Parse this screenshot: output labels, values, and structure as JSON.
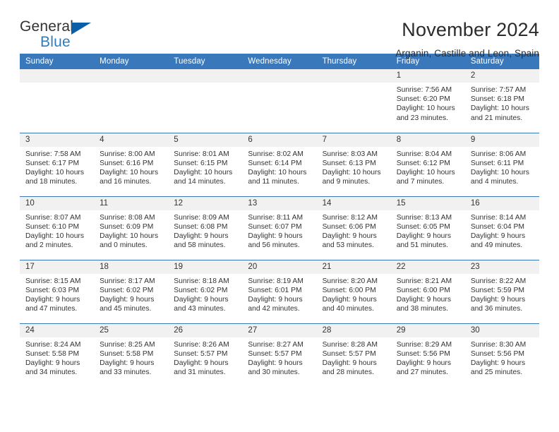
{
  "logo": {
    "word1": "General",
    "word2": "Blue",
    "triangle_color": "#0a5fa8",
    "blue_color": "#2e7bbf"
  },
  "header": {
    "title": "November 2024",
    "subtitle": "Arganin, Castille and Leon, Spain"
  },
  "theme": {
    "header_blue": "#3a78bc",
    "daynum_gray": "#f1f1f1",
    "text": "#333333"
  },
  "calendar": {
    "weekdays": [
      "Sunday",
      "Monday",
      "Tuesday",
      "Wednesday",
      "Thursday",
      "Friday",
      "Saturday"
    ],
    "weeks": [
      [
        {
          "day": "",
          "sunrise": "",
          "sunset": "",
          "daylight": "",
          "empty": true
        },
        {
          "day": "",
          "sunrise": "",
          "sunset": "",
          "daylight": "",
          "empty": true
        },
        {
          "day": "",
          "sunrise": "",
          "sunset": "",
          "daylight": "",
          "empty": true
        },
        {
          "day": "",
          "sunrise": "",
          "sunset": "",
          "daylight": "",
          "empty": true
        },
        {
          "day": "",
          "sunrise": "",
          "sunset": "",
          "daylight": "",
          "empty": true
        },
        {
          "day": "1",
          "sunrise": "Sunrise: 7:56 AM",
          "sunset": "Sunset: 6:20 PM",
          "daylight": "Daylight: 10 hours and 23 minutes."
        },
        {
          "day": "2",
          "sunrise": "Sunrise: 7:57 AM",
          "sunset": "Sunset: 6:18 PM",
          "daylight": "Daylight: 10 hours and 21 minutes."
        }
      ],
      [
        {
          "day": "3",
          "sunrise": "Sunrise: 7:58 AM",
          "sunset": "Sunset: 6:17 PM",
          "daylight": "Daylight: 10 hours and 18 minutes."
        },
        {
          "day": "4",
          "sunrise": "Sunrise: 8:00 AM",
          "sunset": "Sunset: 6:16 PM",
          "daylight": "Daylight: 10 hours and 16 minutes."
        },
        {
          "day": "5",
          "sunrise": "Sunrise: 8:01 AM",
          "sunset": "Sunset: 6:15 PM",
          "daylight": "Daylight: 10 hours and 14 minutes."
        },
        {
          "day": "6",
          "sunrise": "Sunrise: 8:02 AM",
          "sunset": "Sunset: 6:14 PM",
          "daylight": "Daylight: 10 hours and 11 minutes."
        },
        {
          "day": "7",
          "sunrise": "Sunrise: 8:03 AM",
          "sunset": "Sunset: 6:13 PM",
          "daylight": "Daylight: 10 hours and 9 minutes."
        },
        {
          "day": "8",
          "sunrise": "Sunrise: 8:04 AM",
          "sunset": "Sunset: 6:12 PM",
          "daylight": "Daylight: 10 hours and 7 minutes."
        },
        {
          "day": "9",
          "sunrise": "Sunrise: 8:06 AM",
          "sunset": "Sunset: 6:11 PM",
          "daylight": "Daylight: 10 hours and 4 minutes."
        }
      ],
      [
        {
          "day": "10",
          "sunrise": "Sunrise: 8:07 AM",
          "sunset": "Sunset: 6:10 PM",
          "daylight": "Daylight: 10 hours and 2 minutes."
        },
        {
          "day": "11",
          "sunrise": "Sunrise: 8:08 AM",
          "sunset": "Sunset: 6:09 PM",
          "daylight": "Daylight: 10 hours and 0 minutes."
        },
        {
          "day": "12",
          "sunrise": "Sunrise: 8:09 AM",
          "sunset": "Sunset: 6:08 PM",
          "daylight": "Daylight: 9 hours and 58 minutes."
        },
        {
          "day": "13",
          "sunrise": "Sunrise: 8:11 AM",
          "sunset": "Sunset: 6:07 PM",
          "daylight": "Daylight: 9 hours and 56 minutes."
        },
        {
          "day": "14",
          "sunrise": "Sunrise: 8:12 AM",
          "sunset": "Sunset: 6:06 PM",
          "daylight": "Daylight: 9 hours and 53 minutes."
        },
        {
          "day": "15",
          "sunrise": "Sunrise: 8:13 AM",
          "sunset": "Sunset: 6:05 PM",
          "daylight": "Daylight: 9 hours and 51 minutes."
        },
        {
          "day": "16",
          "sunrise": "Sunrise: 8:14 AM",
          "sunset": "Sunset: 6:04 PM",
          "daylight": "Daylight: 9 hours and 49 minutes."
        }
      ],
      [
        {
          "day": "17",
          "sunrise": "Sunrise: 8:15 AM",
          "sunset": "Sunset: 6:03 PM",
          "daylight": "Daylight: 9 hours and 47 minutes."
        },
        {
          "day": "18",
          "sunrise": "Sunrise: 8:17 AM",
          "sunset": "Sunset: 6:02 PM",
          "daylight": "Daylight: 9 hours and 45 minutes."
        },
        {
          "day": "19",
          "sunrise": "Sunrise: 8:18 AM",
          "sunset": "Sunset: 6:02 PM",
          "daylight": "Daylight: 9 hours and 43 minutes."
        },
        {
          "day": "20",
          "sunrise": "Sunrise: 8:19 AM",
          "sunset": "Sunset: 6:01 PM",
          "daylight": "Daylight: 9 hours and 42 minutes."
        },
        {
          "day": "21",
          "sunrise": "Sunrise: 8:20 AM",
          "sunset": "Sunset: 6:00 PM",
          "daylight": "Daylight: 9 hours and 40 minutes."
        },
        {
          "day": "22",
          "sunrise": "Sunrise: 8:21 AM",
          "sunset": "Sunset: 6:00 PM",
          "daylight": "Daylight: 9 hours and 38 minutes."
        },
        {
          "day": "23",
          "sunrise": "Sunrise: 8:22 AM",
          "sunset": "Sunset: 5:59 PM",
          "daylight": "Daylight: 9 hours and 36 minutes."
        }
      ],
      [
        {
          "day": "24",
          "sunrise": "Sunrise: 8:24 AM",
          "sunset": "Sunset: 5:58 PM",
          "daylight": "Daylight: 9 hours and 34 minutes."
        },
        {
          "day": "25",
          "sunrise": "Sunrise: 8:25 AM",
          "sunset": "Sunset: 5:58 PM",
          "daylight": "Daylight: 9 hours and 33 minutes."
        },
        {
          "day": "26",
          "sunrise": "Sunrise: 8:26 AM",
          "sunset": "Sunset: 5:57 PM",
          "daylight": "Daylight: 9 hours and 31 minutes."
        },
        {
          "day": "27",
          "sunrise": "Sunrise: 8:27 AM",
          "sunset": "Sunset: 5:57 PM",
          "daylight": "Daylight: 9 hours and 30 minutes."
        },
        {
          "day": "28",
          "sunrise": "Sunrise: 8:28 AM",
          "sunset": "Sunset: 5:57 PM",
          "daylight": "Daylight: 9 hours and 28 minutes."
        },
        {
          "day": "29",
          "sunrise": "Sunrise: 8:29 AM",
          "sunset": "Sunset: 5:56 PM",
          "daylight": "Daylight: 9 hours and 27 minutes."
        },
        {
          "day": "30",
          "sunrise": "Sunrise: 8:30 AM",
          "sunset": "Sunset: 5:56 PM",
          "daylight": "Daylight: 9 hours and 25 minutes."
        }
      ]
    ]
  }
}
